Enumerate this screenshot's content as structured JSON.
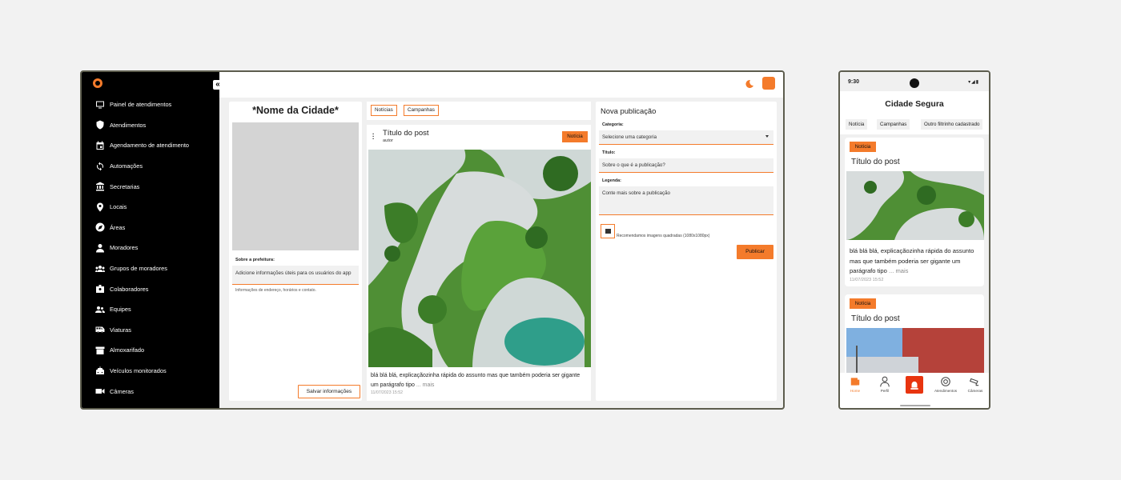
{
  "desktop": {
    "sidebar": {
      "items": [
        {
          "label": "Painel de atendimentos",
          "icon": "monitor-icon"
        },
        {
          "label": "Atendimentos",
          "icon": "shield-icon"
        },
        {
          "label": "Agendamento de atendimento",
          "icon": "calendar-icon"
        },
        {
          "label": "Automações",
          "icon": "sync-icon"
        },
        {
          "label": "Secretarias",
          "icon": "bank-icon"
        },
        {
          "label": "Locais",
          "icon": "pin-icon"
        },
        {
          "label": "Áreas",
          "icon": "compass-icon"
        },
        {
          "label": "Moradores",
          "icon": "person-icon"
        },
        {
          "label": "Grupos de moradores",
          "icon": "groups-icon"
        },
        {
          "label": "Colaboradores",
          "icon": "badge-icon"
        },
        {
          "label": "Equipes",
          "icon": "people-icon"
        },
        {
          "label": "Viaturas",
          "icon": "bus-icon"
        },
        {
          "label": "Almoxarifado",
          "icon": "archive-icon"
        },
        {
          "label": "Veículos monitorados",
          "icon": "car-icon"
        },
        {
          "label": "Câmeras",
          "icon": "camera-icon"
        }
      ],
      "collapse_label": "«"
    },
    "city_panel": {
      "title": "*Nome da Cidade*",
      "about_label": "Sobre a prefeitura:",
      "about_value": "Adicione informações úteis para os usuários do app",
      "hint": "Informações de endereço, horários e contato.",
      "save_label": "Salvar informações"
    },
    "feed": {
      "filters": [
        "Notícias",
        "Campanhas"
      ],
      "post": {
        "title": "Título do post",
        "author": "autor",
        "tag": "Notícia",
        "description": "blá blá blá, explicaçãozinha rápida do assunto mas que também poderia ser gigante um parágrafo tipo",
        "more": "... mais",
        "date": "11/07/2023 15:52"
      }
    },
    "new_post": {
      "title": "Nova publicação",
      "category_label": "Categoria:",
      "category_value": "Selecione uma categoria",
      "title_label": "Título:",
      "title_placeholder": "Sobre o que é a publicação?",
      "caption_label": "Legenda:",
      "caption_placeholder": "Conte mais sobre a publicação",
      "image_hint": "Recomendamos imagens quadradas (1080x1080px)",
      "publish_label": "Publicar"
    }
  },
  "phone": {
    "time": "9:30",
    "title": "Cidade Segura",
    "filters": [
      "Notícia",
      "Campanhas",
      "Outro filtrinho cadastrado"
    ],
    "posts": [
      {
        "tag": "Notícia",
        "title": "Título do post",
        "description": "blá blá blá, explicaçãozinha rápida do assunto mas que também poderia ser gigante um parágrafo tipo",
        "more": "... mais",
        "date": "11/07/2023 15:52"
      },
      {
        "tag": "Notícia",
        "title": "Título do post"
      }
    ],
    "tabs": [
      "Home",
      "Perfil",
      "Atendimentos",
      "Câmeras"
    ],
    "active_tab": "Home"
  },
  "colors": {
    "accent": "#f47b2b",
    "sidebar": "#000000",
    "sos": "#e8340f"
  }
}
